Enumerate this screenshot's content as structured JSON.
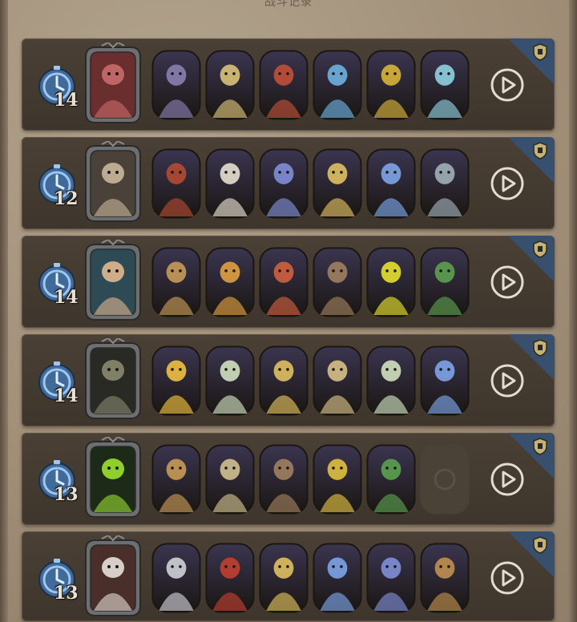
{
  "header": {
    "title": "战斗记录"
  },
  "rows": [
    {
      "turns": "14",
      "boss": {
        "name": "pirate-pig",
        "bg": "#6b2e2e",
        "accent": "#c96b6b"
      },
      "heroes": [
        {
          "name": "dragon-grey",
          "bg": "#3b3550",
          "accent": "#8a7fb0"
        },
        {
          "name": "chef",
          "bg": "#4e5a30",
          "accent": "#d9c27a"
        },
        {
          "name": "red-dragon",
          "bg": "#5a2620",
          "accent": "#c0503a"
        },
        {
          "name": "blue-mage",
          "bg": "#2e4a6b",
          "accent": "#6fb1e0"
        },
        {
          "name": "black-dragon",
          "bg": "#2b3440",
          "accent": "#d8b43a"
        },
        {
          "name": "ice-dragon",
          "bg": "#2a5060",
          "accent": "#8fd0e0"
        }
      ]
    },
    {
      "turns": "12",
      "boss": {
        "name": "deer-elder",
        "bg": "#4a4238",
        "accent": "#c9b79a"
      },
      "heroes": [
        {
          "name": "red-hood",
          "bg": "#5a2a22",
          "accent": "#b44a34"
        },
        {
          "name": "goat-sage",
          "bg": "#3a4a5a",
          "accent": "#e6e0d0"
        },
        {
          "name": "blue-wizard",
          "bg": "#2d3b5e",
          "accent": "#7f8fd8"
        },
        {
          "name": "golden-knight",
          "bg": "#3b4560",
          "accent": "#e0c060"
        },
        {
          "name": "star-witch",
          "bg": "#302a5a",
          "accent": "#7da4e8"
        },
        {
          "name": "lantern-golem",
          "bg": "#3a4a40",
          "accent": "#a0b0b8"
        }
      ]
    },
    {
      "turns": "14",
      "boss": {
        "name": "sea-captain",
        "bg": "#2d4a55",
        "accent": "#e0b890"
      },
      "heroes": [
        {
          "name": "brass-mech",
          "bg": "#4a3a28",
          "accent": "#c89a58"
        },
        {
          "name": "box-robot",
          "bg": "#2f2e2a",
          "accent": "#e0a040"
        },
        {
          "name": "fire-dragon",
          "bg": "#5a2418",
          "accent": "#d06040"
        },
        {
          "name": "forest-girl",
          "bg": "#3a4030",
          "accent": "#a08060"
        },
        {
          "name": "shadow-bot",
          "bg": "#2b2a22",
          "accent": "#e6e030"
        },
        {
          "name": "castle-walker",
          "bg": "#3a3a48",
          "accent": "#5ca050"
        }
      ]
    },
    {
      "turns": "14",
      "boss": {
        "name": "hooded-rogue",
        "bg": "#2a2a24",
        "accent": "#8a8a70"
      },
      "heroes": [
        {
          "name": "sun-priestess",
          "bg": "#4a2420",
          "accent": "#f0c040"
        },
        {
          "name": "white-stag",
          "bg": "#2e4a40",
          "accent": "#d0e0c0"
        },
        {
          "name": "gold-pharaoh",
          "bg": "#3a3450",
          "accent": "#e0c060"
        },
        {
          "name": "dwarf-king",
          "bg": "#3a3a50",
          "accent": "#d8c088"
        },
        {
          "name": "white-stag-2",
          "bg": "#2e4a40",
          "accent": "#d0e0c0"
        },
        {
          "name": "star-witch-2",
          "bg": "#302a5a",
          "accent": "#7da4e8"
        }
      ]
    },
    {
      "turns": "13",
      "boss": {
        "name": "shadow-beast",
        "bg": "#1e2a18",
        "accent": "#9ae030"
      },
      "heroes": [
        {
          "name": "brass-mech-2",
          "bg": "#4a3a28",
          "accent": "#c89a58"
        },
        {
          "name": "tesla-tower",
          "bg": "#2e302c",
          "accent": "#d0c090"
        },
        {
          "name": "forest-girl-2",
          "bg": "#3a4030",
          "accent": "#a08060"
        },
        {
          "name": "gold-golem",
          "bg": "#3a3422",
          "accent": "#e0c040"
        },
        {
          "name": "castle-walker-2",
          "bg": "#3a3a48",
          "accent": "#5ca050"
        },
        {
          "name": "empty-slot",
          "bg": "#4a4137",
          "accent": "#5a5045",
          "empty": true
        }
      ]
    },
    {
      "turns": "13",
      "boss": {
        "name": "cowboy-hat",
        "bg": "#4a2e2a",
        "accent": "#e6e0d8"
      },
      "heroes": [
        {
          "name": "bone-dragon",
          "bg": "#3b3a44",
          "accent": "#d0d0d8"
        },
        {
          "name": "red-drake",
          "bg": "#4a2420",
          "accent": "#c04030"
        },
        {
          "name": "golden-knight-2",
          "bg": "#3b4560",
          "accent": "#e0c060"
        },
        {
          "name": "star-witch-3",
          "bg": "#302a5a",
          "accent": "#7da4e8"
        },
        {
          "name": "blue-wizard-2",
          "bg": "#2d3b5e",
          "accent": "#7f8fd8"
        },
        {
          "name": "chest-crab",
          "bg": "#2a2e26",
          "accent": "#c09050"
        }
      ]
    }
  ]
}
